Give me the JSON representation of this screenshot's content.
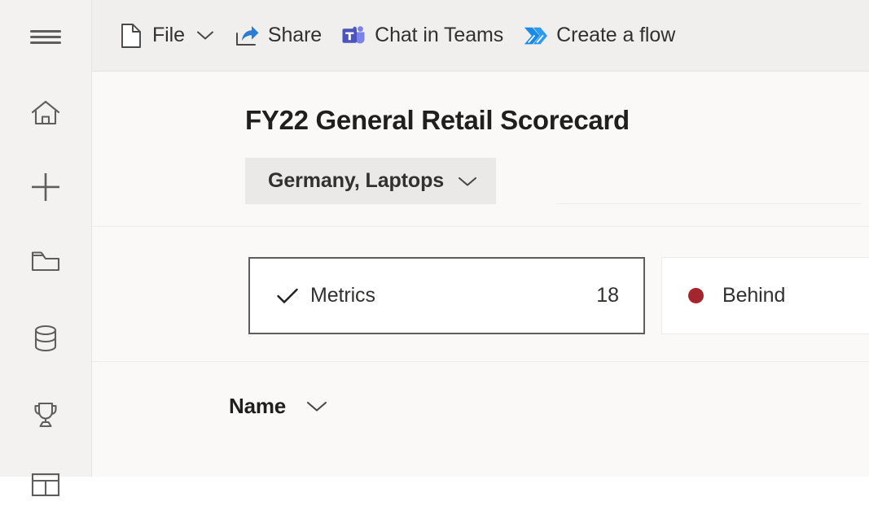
{
  "rail": {
    "items": [
      {
        "icon": "hamburger-menu-icon",
        "name": "nav-toggle"
      },
      {
        "icon": "home-icon",
        "name": "home"
      },
      {
        "icon": "plus-icon",
        "name": "create"
      },
      {
        "icon": "folder-icon",
        "name": "browse"
      },
      {
        "icon": "database-icon",
        "name": "data"
      },
      {
        "icon": "trophy-icon",
        "name": "goals"
      },
      {
        "icon": "table-icon",
        "name": "workspace"
      }
    ]
  },
  "commandbar": {
    "items": [
      {
        "label": "File",
        "icon": "file-icon",
        "caret": true
      },
      {
        "label": "Share",
        "icon": "share-icon",
        "caret": false
      },
      {
        "label": "Chat in Teams",
        "icon": "teams-icon",
        "caret": false
      },
      {
        "label": "Create a flow",
        "icon": "power-automate-icon",
        "caret": false
      }
    ]
  },
  "header": {
    "title": "FY22 General Retail Scorecard",
    "filter": {
      "label": "Germany, Laptops",
      "caret_icon": "chevron-down-icon"
    }
  },
  "status_cards": [
    {
      "label": "Metrics",
      "count": "18",
      "icon": "checkmark-icon",
      "selected": true
    },
    {
      "label": "Behind",
      "count": "",
      "icon": "status-dot-icon",
      "dot_color": "#a4262c",
      "selected": false
    }
  ],
  "table": {
    "columns": [
      {
        "label": "Name",
        "sort_icon": "chevron-down-icon"
      }
    ]
  },
  "colors": {
    "rail_bg": "#f3f2f1",
    "commandbar_bg": "#f0efee",
    "content_bg": "#faf9f8",
    "card_bg": "#ffffff",
    "selected_border": "#605e5c",
    "behind_red": "#a4262c",
    "teams_purple": "#5059c9",
    "share_blue": "#2b7cd3",
    "flow_blue": "#0f85e0",
    "text": "#323130"
  }
}
